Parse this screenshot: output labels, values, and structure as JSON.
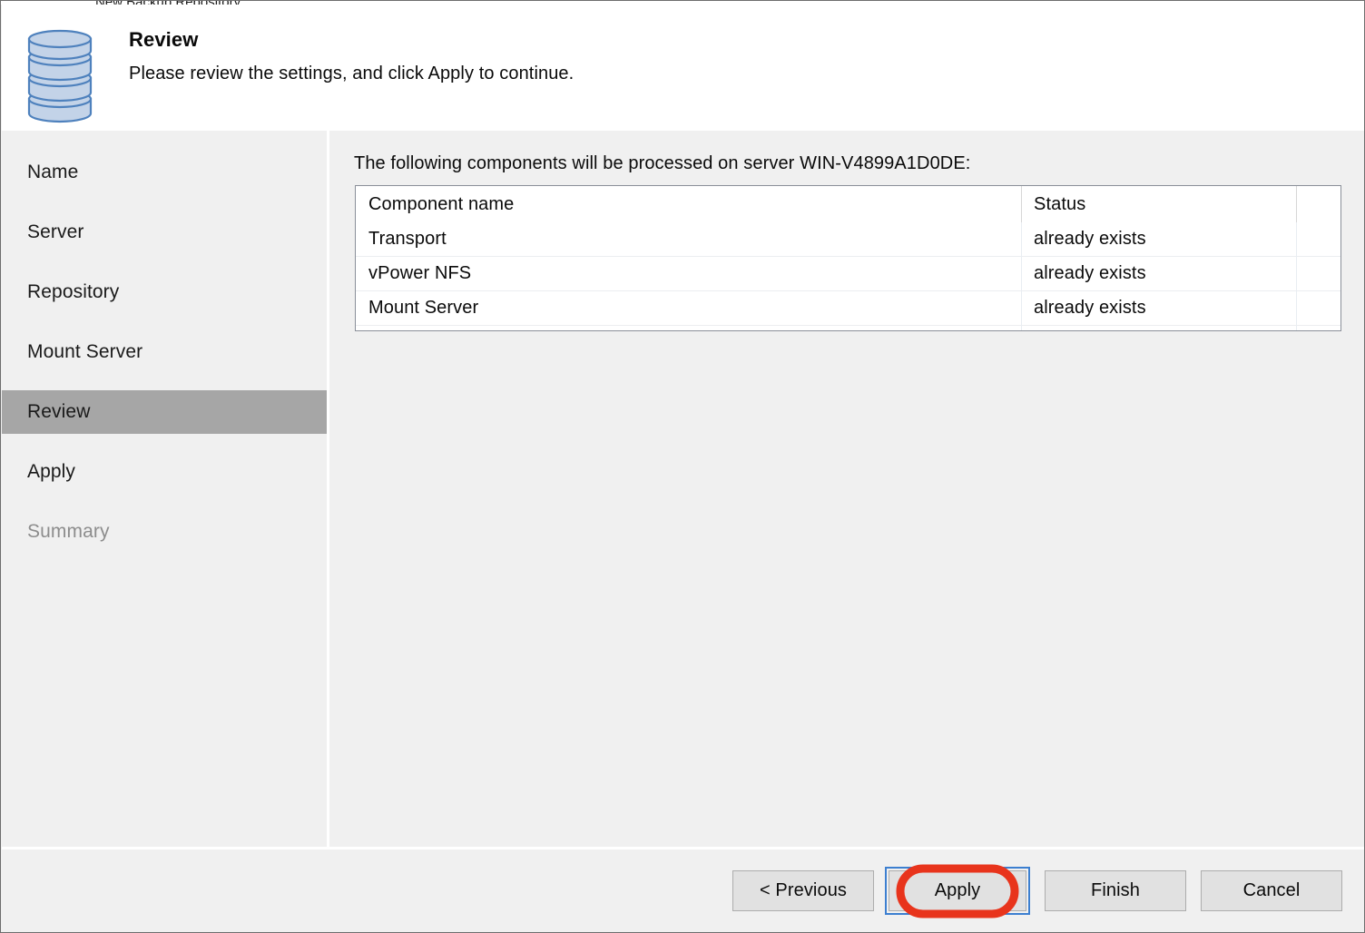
{
  "window": {
    "clipped_titlebar_text": "New Backup Repository",
    "icon": "database-cylinder-icon"
  },
  "header": {
    "title": "Review",
    "subtitle": "Please review the settings, and click Apply to continue."
  },
  "sidebar": {
    "items": [
      {
        "label": "Name",
        "state": "normal"
      },
      {
        "label": "Server",
        "state": "normal"
      },
      {
        "label": "Repository",
        "state": "normal"
      },
      {
        "label": "Mount Server",
        "state": "normal"
      },
      {
        "label": "Review",
        "state": "selected"
      },
      {
        "label": "Apply",
        "state": "normal"
      },
      {
        "label": "Summary",
        "state": "disabled"
      }
    ]
  },
  "main": {
    "intro": "The following components will be processed on server WIN-V4899A1D0DE:",
    "server_name": "WIN-V4899A1D0DE",
    "table": {
      "columns": [
        "Component name",
        "Status",
        ""
      ],
      "rows": [
        {
          "component": "Transport",
          "status": "already exists",
          "extra": ""
        },
        {
          "component": "vPower NFS",
          "status": "already exists",
          "extra": ""
        },
        {
          "component": "Mount Server",
          "status": "already exists",
          "extra": ""
        },
        {
          "component": "",
          "status": "",
          "extra": ""
        },
        {
          "component": "",
          "status": "",
          "extra": ""
        }
      ]
    }
  },
  "footer": {
    "buttons": [
      {
        "label": "< Previous",
        "focused": false
      },
      {
        "label": "Apply",
        "focused": true
      },
      {
        "label": "Finish",
        "focused": false
      },
      {
        "label": "Cancel",
        "focused": false
      }
    ]
  },
  "annotation": {
    "shape": "red-ellipse-highlight",
    "target": "Apply",
    "color": "#E8341C"
  },
  "colors": {
    "window_bg": "#f0f0f0",
    "header_bg": "#ffffff",
    "selected_nav_bg": "#a6a6a6",
    "disabled_text": "#8d8d8d",
    "grid_border": "#8a8f99",
    "focus_ring": "#3c7fd0",
    "annotation_red": "#E8341C",
    "icon_blue": "#4e81bd",
    "icon_fill": "#c3d3e8"
  }
}
